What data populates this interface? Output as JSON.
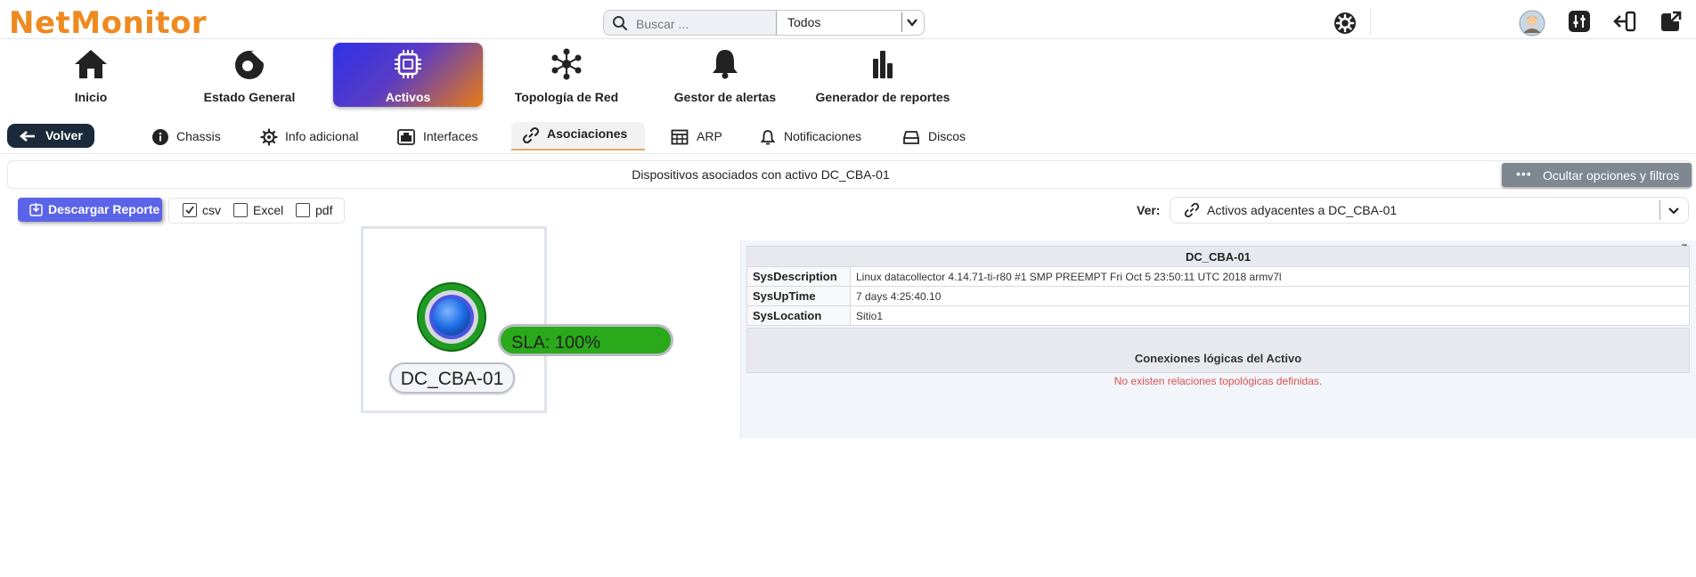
{
  "app": {
    "logo": "NetMonitor"
  },
  "search": {
    "placeholder": "Buscar ...",
    "value": ""
  },
  "filter": {
    "selected": "Todos"
  },
  "header_icons": [
    "gear-icon",
    "avatar",
    "sliders-icon",
    "logout-icon",
    "external-window-icon"
  ],
  "nav": {
    "inicio": "Inicio",
    "estado_general": "Estado General",
    "activos": "Activos",
    "topologia": "Topología de Red",
    "alertas": "Gestor de alertas",
    "reportes": "Generador de reportes"
  },
  "subnav": {
    "back": "Volver",
    "chassis": "Chassis",
    "info": "Info adicional",
    "interfaces": "Interfaces",
    "asociaciones": "Asociaciones",
    "arp": "ARP",
    "notificaciones": "Notificaciones",
    "discos": "Discos"
  },
  "page": {
    "title": "Dispositivos asociados con activo DC_CBA-01",
    "toggle_filters": "Ocultar opciones y filtros"
  },
  "report": {
    "download": "Descargar Reporte",
    "formats": [
      {
        "label": "csv",
        "checked": true
      },
      {
        "label": "Excel",
        "checked": false
      },
      {
        "label": "pdf",
        "checked": false
      }
    ]
  },
  "view": {
    "label": "Ver:",
    "selected": "Activos adyacentes a DC_CBA-01"
  },
  "node": {
    "name": "DC_CBA-01",
    "sla": "SLA: 100%",
    "sla_value": 1.0
  },
  "info": {
    "title": "DC_CBA-01",
    "rows": [
      {
        "key": "SysDescription",
        "value": "Linux datacollector 4.14.71-ti-r80 #1 SMP PREEMPT Fri Oct 5 23:50:11 UTC 2018 armv7l"
      },
      {
        "key": "SysUpTime",
        "value": "7 days 4:25:40.10"
      },
      {
        "key": "SysLocation",
        "value": "Sitio1"
      }
    ],
    "connections_title": "Conexiones lógicas del Activo",
    "no_relations": "No existen relaciones topológicas definidas."
  },
  "colors": {
    "accent": "#ee8a1f",
    "primary": "#5b64e8",
    "sla_green": "#2aa91a",
    "error": "#d9534f"
  }
}
